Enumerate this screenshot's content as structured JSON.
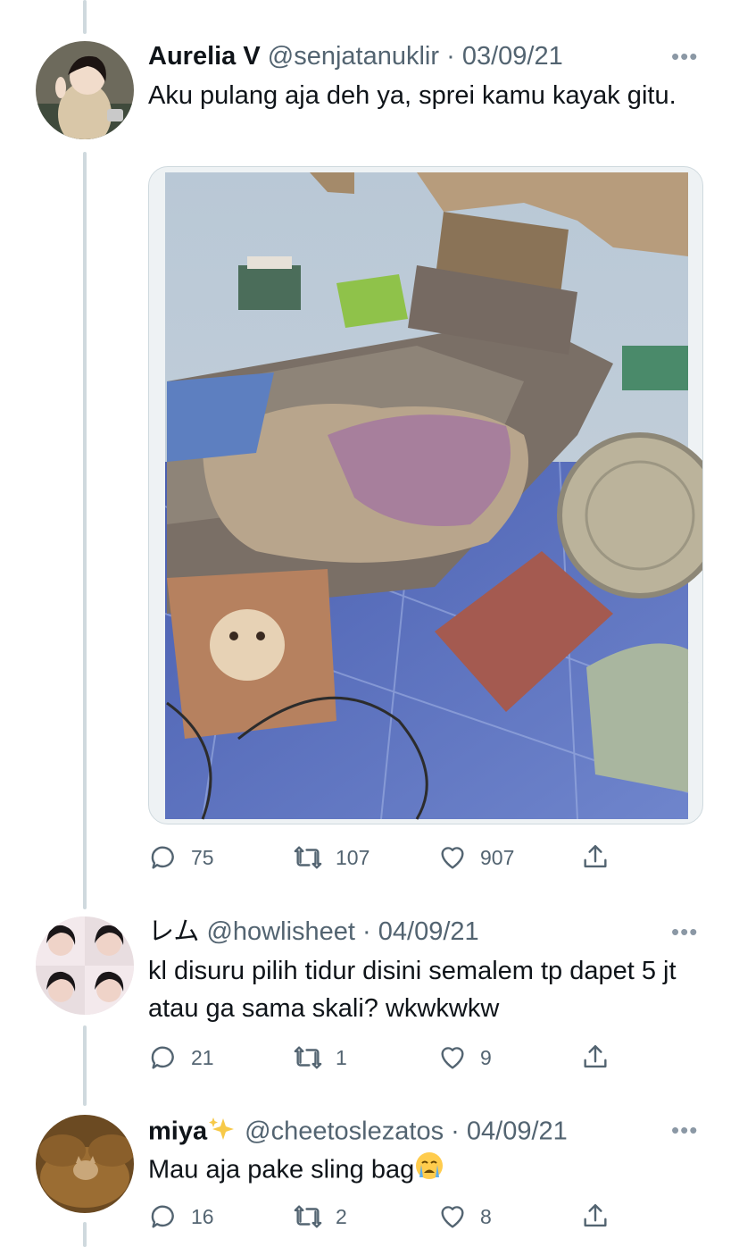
{
  "tweets": [
    {
      "name": "Aurelia V",
      "handle": "@senjatanuklir",
      "separator": "·",
      "date": "03/09/21",
      "text": "Aku pulang aja deh ya, sprei kamu kayak gitu.",
      "replies": "75",
      "retweets": "107",
      "likes": "907"
    },
    {
      "name": "レム",
      "handle": "@howlisheet",
      "separator": "·",
      "date": "04/09/21",
      "text": "kl disuru pilih tidur disini semalem tp dapet 5 jt atau ga sama skali? wkwkwkw",
      "replies": "21",
      "retweets": "1",
      "likes": "9"
    },
    {
      "name": "miya",
      "name_emoji": "sparkles-icon",
      "handle": "@cheetoslezatos",
      "separator": "·",
      "date": "04/09/21",
      "text": "Mau aja pake sling bag",
      "text_emoji": "crying-face-icon",
      "replies": "16",
      "retweets": "2",
      "likes": "8"
    }
  ],
  "icons": {
    "reply": "reply-icon",
    "retweet": "retweet-icon",
    "like": "heart-icon",
    "share": "share-icon",
    "more": "more-options-icon"
  },
  "colors": {
    "primary_text": "#0f1419",
    "secondary_text": "#536471",
    "thread_line": "#cfd9de",
    "background": "#ffffff"
  }
}
